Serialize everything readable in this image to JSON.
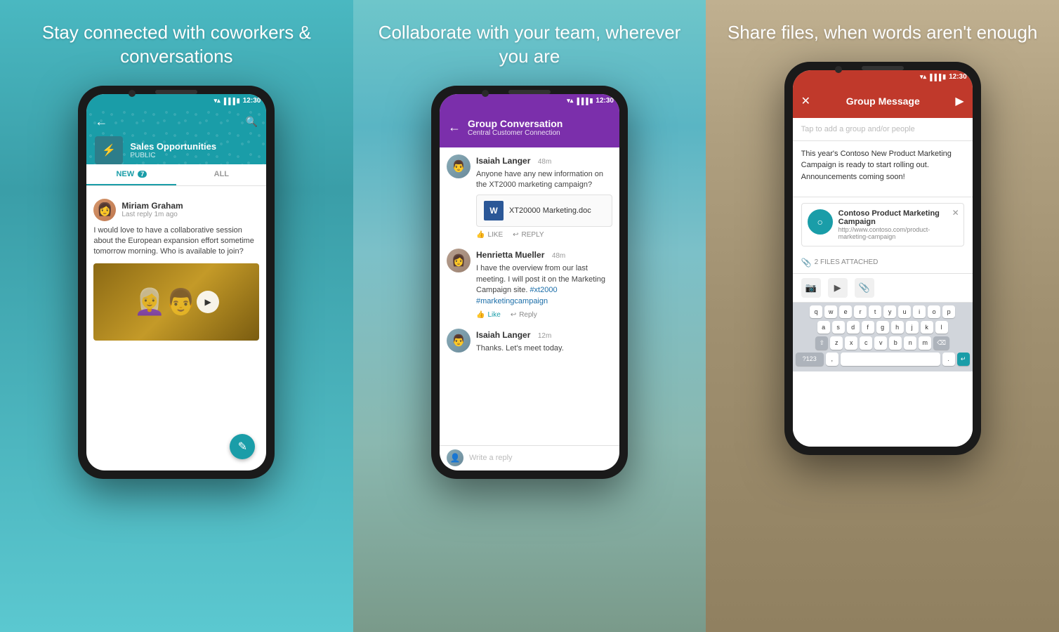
{
  "panel1": {
    "title": "Stay connected with coworkers & conversations",
    "status_time": "12:30",
    "group_name": "Sales Opportunities",
    "group_type": "PUBLIC",
    "tab_new": "NEW",
    "tab_new_count": "7",
    "tab_all": "ALL",
    "post_author": "Miriam Graham",
    "post_time": "Last reply 1m ago",
    "post_text": "I would love to have a collaborative session about the European expansion effort sometime tomorrow morning. Who is available to join?",
    "fab_icon": "✎"
  },
  "panel2": {
    "title": "Collaborate with your team, wherever you are",
    "status_time": "12:30",
    "header_title": "Group Conversation",
    "header_subtitle": "Central Customer Connection",
    "msg1_author": "Isaiah Langer",
    "msg1_time": "48m",
    "msg1_text": "Anyone have any new information on the XT2000 marketing campaign?",
    "file_name": "XT20000 Marketing.doc",
    "action_like": "LIKE",
    "action_reply": "REPLY",
    "msg2_author": "Henrietta Mueller",
    "msg2_time": "48m",
    "msg2_text": "I have the overview from our last meeting. I will post it on the Marketing Campaign site. #xt2000 #marketingcampaign",
    "msg2_action_like": "Like",
    "msg2_action_reply": "Reply",
    "msg3_author": "Isaiah Langer",
    "msg3_time": "12m",
    "msg3_text": "Thanks. Let's meet today.",
    "reply_placeholder": "Write a reply"
  },
  "panel3": {
    "title": "Share files, when words aren't enough",
    "status_time": "12:30",
    "header_title": "Group Message",
    "to_placeholder": "Tap to add a group and/or people",
    "compose_text": "This year's Contoso New Product Marketing Campaign is ready to start rolling out. Announcements coming soon!",
    "link_title": "Contoso Product Marketing Campaign",
    "link_url": "http://www.contoso.com/product-marketing-campaign",
    "files_attached": "2 FILES ATTACHED",
    "keyboard_row1": [
      "q",
      "w",
      "e",
      "r",
      "t",
      "y",
      "u",
      "i",
      "o",
      "p"
    ],
    "keyboard_row2": [
      "a",
      "s",
      "d",
      "f",
      "g",
      "h",
      "j",
      "k",
      "l"
    ],
    "keyboard_row3": [
      "z",
      "x",
      "c",
      "v",
      "b",
      "n",
      "m"
    ],
    "keyboard_bottom": [
      "?123",
      ",",
      "space",
      "."
    ]
  }
}
